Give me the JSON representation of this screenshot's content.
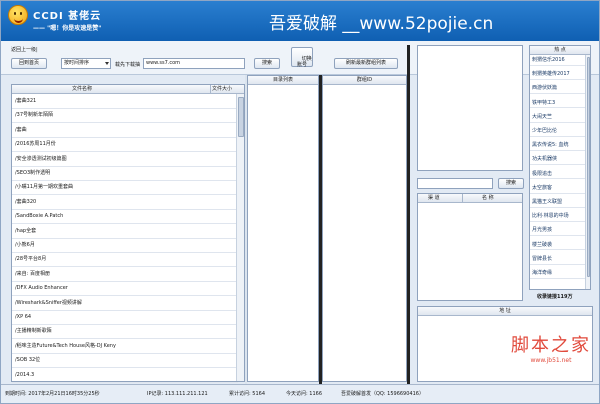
{
  "app": {
    "title": "CCDI 甚佬云",
    "slogan": "—— \"嗯！你是攻速是赞\"",
    "site_banner": "吾爱破解 __www.52pojie.cn"
  },
  "toolbar": {
    "back_label": "返回上一级|",
    "home_button": "回到首页",
    "sort_select": "按时间排序",
    "url_label": "载先下载抽",
    "url_value": "www.ss7.com",
    "search_button": "搜索",
    "switch_account_button": "切换\n账号",
    "refresh_button": "刷新最新群组列表"
  },
  "file_panel": {
    "col_name": "文件名称",
    "col_size": "文件大小",
    "rows": [
      "/套曲321",
      "/37号制新年陌陌",
      "/套曲",
      "/2016苏周11月份",
      "/安全渗透测试初级篇图",
      "/SEO3制作透明",
      "/小嘴11月第一期欢重套曲",
      "/套曲320",
      "/SandBoxie A.Patch",
      "/hap全套",
      "/小熊6月",
      "/28号平台8月",
      "/来自: 百度相册",
      "/DFX Audio Enhancer",
      "/Wireshark&Sniffer视频讲解",
      "/XP 64",
      "/主播精制新歌陌",
      "/稻味主造Future&Tech House风格-DJ Keny",
      "/SOB 32位",
      "/2014.3"
    ]
  },
  "dir_panel": {
    "header": "目录列表"
  },
  "group_panel": {
    "header": "群组ID"
  },
  "channel_panel": {
    "search_button": "搜索",
    "col_channel": "渠 道",
    "col_name": "名 称"
  },
  "address_panel": {
    "header": "地 址"
  },
  "hot_panel": {
    "header": "热 点",
    "items": [
      "刺猬信乐2016",
      "刺猬英雄传2017",
      "西游伏妖篇",
      "铁甲特工3",
      "大闹天竺",
      "少年巴比伦",
      "黑衣传说5: 血统",
      "功夫机器侠",
      "极限追击",
      "太空旅客",
      "黑猫王义联盟",
      "比利·林恩的中场",
      "月光男孩",
      "楼兰破袭",
      "冒牌县长",
      "海洋奇缘"
    ],
    "count_label": "收录链接119万"
  },
  "status": {
    "expire": "到期时间: 2017年2月21日16时35分25秒",
    "ip": "IP记录: 113.111.211.121",
    "total": "累计访问: 5164",
    "today": "今天访问: 1166",
    "qq": "吾爱破解首发（QQ: 1596690416）"
  },
  "watermark": {
    "main": "脚本之家",
    "sub": "www.jb51.net"
  },
  "colors": {
    "banner": "#1a6fc5",
    "watermark": "#e14a3c"
  }
}
